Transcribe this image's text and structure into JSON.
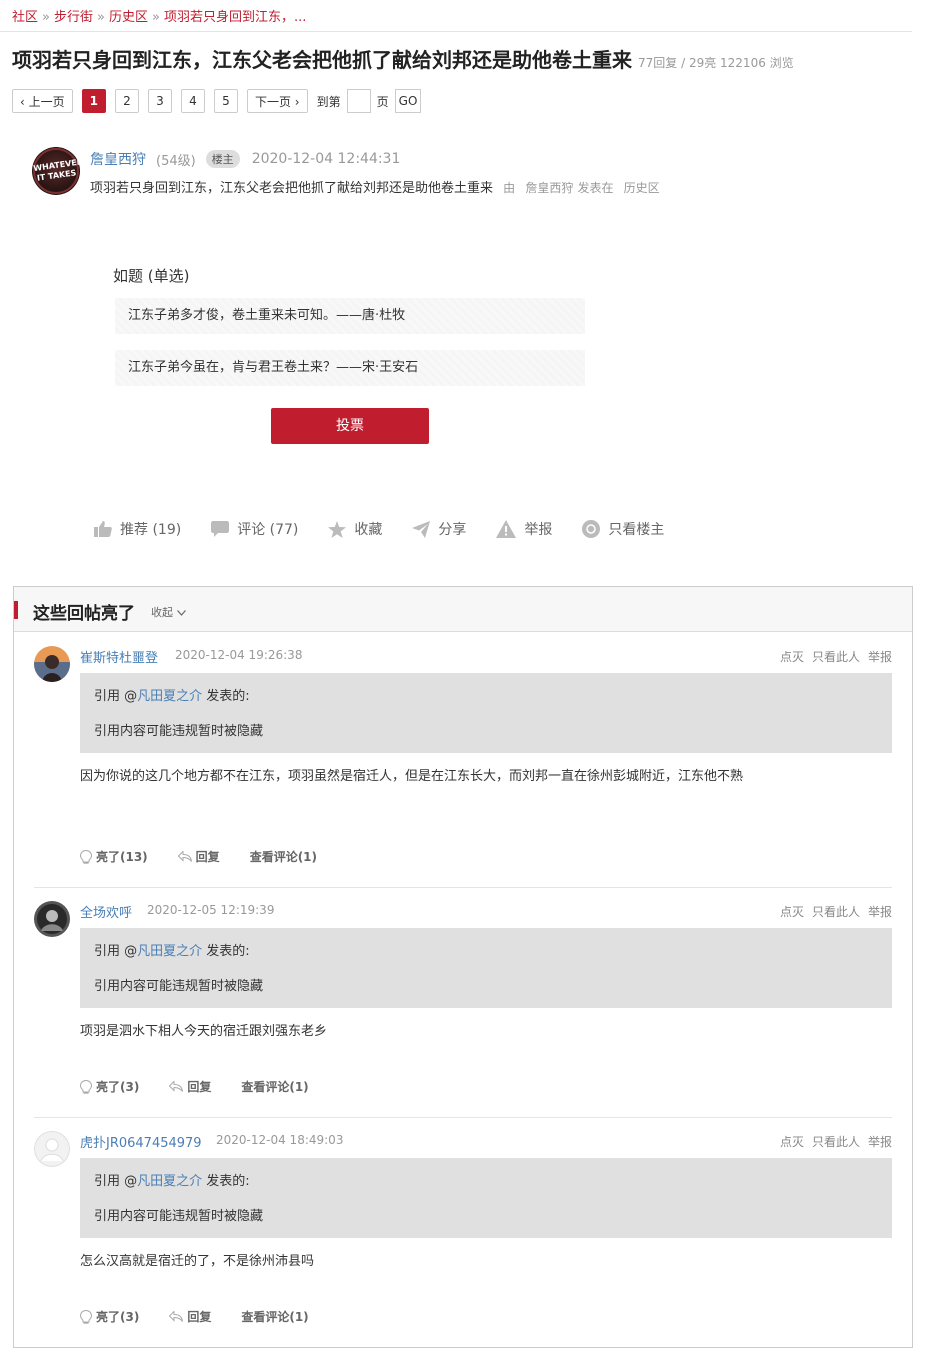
{
  "breadcrumb": [
    "社区",
    "步行街",
    "历史区",
    "项羽若只身回到江东，..."
  ],
  "title": "项羽若只身回到江东，江东父老会把他抓了献给刘邦还是助他卷土重来",
  "meta": "77回复 / 29亮 122106 浏览",
  "pager": {
    "prev": "‹ 上一页",
    "pages": [
      "1",
      "2",
      "3",
      "4",
      "5"
    ],
    "next": "下一页 ›",
    "goto_pre": "到第",
    "goto_post": "页",
    "go": "GO"
  },
  "op": {
    "avatar_text": "WHATEVER IT TAKES",
    "name": "詹皇西狩",
    "level": "(54级)",
    "badge": "楼主",
    "time": "2020-12-04 12:44:31",
    "subtitle": "项羽若只身回到江东，江东父老会把他抓了献给刘邦还是助他卷土重来",
    "by": "由",
    "by_name": "詹皇西狩",
    "posted_in": "发表在",
    "board": "历史区"
  },
  "poll": {
    "question": "如题 (单选)",
    "options": [
      "江东子弟多才俊，卷土重来未可知。——唐·杜牧",
      "江东子弟今虽在，肯与君王卷土来？——宋·王安石"
    ],
    "vote": "投票"
  },
  "actions": {
    "recommend": "推荐 (19)",
    "comment": "评论 (77)",
    "favorite": "收藏",
    "share": "分享",
    "report": "举报",
    "only_op": "只看楼主"
  },
  "highlights": {
    "title": "这些回帖亮了",
    "collapse": "收起",
    "reply_ops": [
      "点灭",
      "只看此人",
      "举报"
    ],
    "quote_prefix": "引用 @",
    "quote_suffix": "发表的:",
    "replies": [
      {
        "name": "崔斯特杜噩登",
        "time": "2020-12-04 19:26:38",
        "quote_user": "凡田夏之介",
        "quote_text": "引用内容可能违规暂时被隐藏",
        "content": "因为你说的这几个地方都不在江东，项羽虽然是宿迁人，但是在江东长大，而刘邦一直在徐州彭城附近，江东他不熟",
        "light": "亮了(13)",
        "reply": "回复",
        "view": "查看评论(1)"
      },
      {
        "name": "全场欢呼",
        "time": "2020-12-05 12:19:39",
        "quote_user": "凡田夏之介",
        "quote_text": "引用内容可能违规暂时被隐藏",
        "content": "项羽是泗水下相人今天的宿迁跟刘强东老乡",
        "light": "亮了(3)",
        "reply": "回复",
        "view": "查看评论(1)"
      },
      {
        "name": "虎扑JR0647454979",
        "time": "2020-12-04 18:49:03",
        "quote_user": "凡田夏之介",
        "quote_text": "引用内容可能违规暂时被隐藏",
        "content": "怎么汉高就是宿迁的了，不是徐州沛县吗",
        "light": "亮了(3)",
        "reply": "回复",
        "view": "查看评论(1)"
      }
    ]
  }
}
